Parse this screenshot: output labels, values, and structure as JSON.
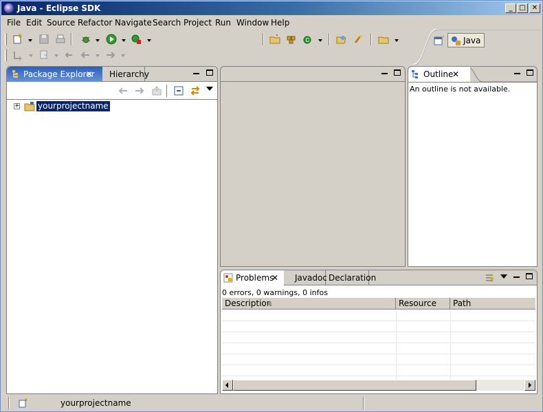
{
  "window": {
    "title": "Java - Eclipse SDK",
    "min_glyph": "_",
    "max_glyph": "□",
    "close_glyph": "✕"
  },
  "menu": [
    "File",
    "Edit",
    "Source",
    "Refactor",
    "Navigate",
    "Search",
    "Project",
    "Run",
    "Window",
    "Help"
  ],
  "perspective": {
    "active_label": "Java"
  },
  "package_explorer": {
    "tabs": [
      {
        "label": "Package Explorer"
      },
      {
        "label": "Hierarchy"
      }
    ],
    "tree": [
      {
        "label": "yourprojectname",
        "expander": "+"
      }
    ]
  },
  "outline": {
    "tab_label": "Outline",
    "message": "An outline is not available."
  },
  "problems": {
    "tabs": [
      {
        "label": "Problems"
      },
      {
        "label": "Javadoc"
      },
      {
        "label": "Declaration"
      }
    ],
    "summary": "0 errors, 0 warnings, 0 infos",
    "columns": [
      "Description",
      "Resource",
      "Path"
    ]
  },
  "status": {
    "text": "yourprojectname"
  },
  "colors": {
    "selection": "#0a246a",
    "titlebar_start": "#0a246a",
    "titlebar_end": "#a6caf0",
    "chrome": "#d4d0c8"
  }
}
